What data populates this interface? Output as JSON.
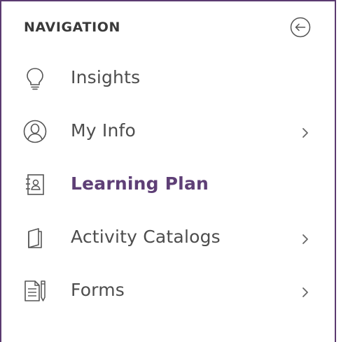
{
  "navigation": {
    "title": "NAVIGATION",
    "collapse_icon": "arrow-left-circle-icon",
    "items": [
      {
        "label": "Insights",
        "icon": "lightbulb-icon",
        "has_submenu": false,
        "active": false
      },
      {
        "label": "My Info",
        "icon": "user-circle-icon",
        "has_submenu": true,
        "active": false
      },
      {
        "label": "Learning Plan",
        "icon": "contact-book-icon",
        "has_submenu": false,
        "active": true
      },
      {
        "label": "Activity Catalogs",
        "icon": "book-icon",
        "has_submenu": true,
        "active": false
      },
      {
        "label": "Forms",
        "icon": "form-pencil-icon",
        "has_submenu": true,
        "active": false
      }
    ]
  },
  "colors": {
    "frame_border": "#5b3a70",
    "active_text": "#5e3f76",
    "text": "#4d4d4d",
    "icon": "#555555"
  }
}
